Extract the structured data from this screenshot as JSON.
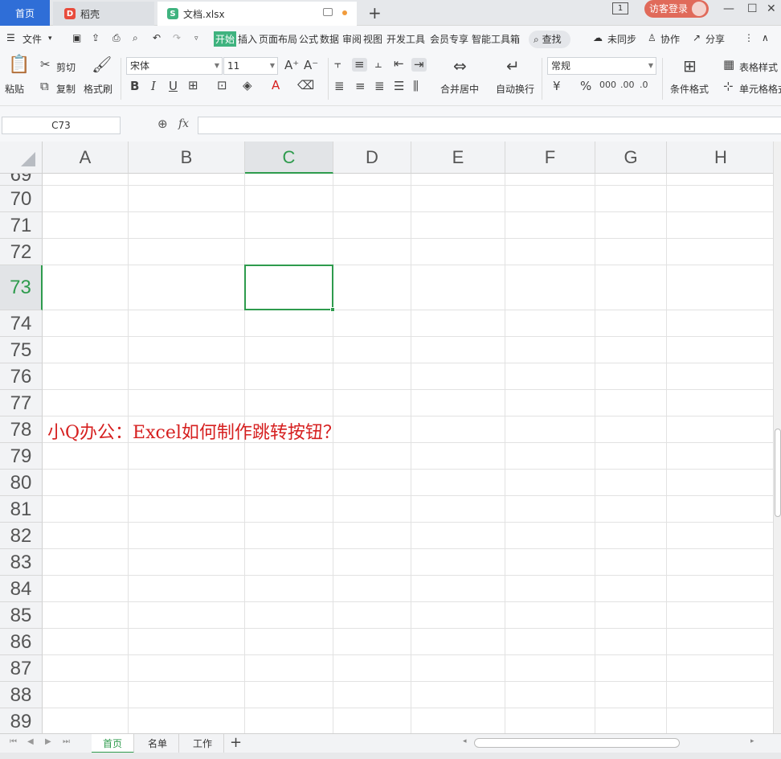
{
  "tabs": {
    "home": "首页",
    "daoke": "稻壳",
    "doc": "文档.xlsx",
    "doc_icon": "S",
    "daoke_icon": "D"
  },
  "window": {
    "badge": "1",
    "login": "访客登录"
  },
  "menu": {
    "file": "文件",
    "items": [
      "开始",
      "插入",
      "页面布局",
      "公式",
      "数据",
      "审阅",
      "视图",
      "开发工具",
      "会员专享",
      "智能工具箱"
    ],
    "search": "查找",
    "unsync": "未同步",
    "collab": "协作",
    "share": "分享"
  },
  "ribbon": {
    "paste": "粘贴",
    "cut": "剪切",
    "copy": "复制",
    "format_painter": "格式刷",
    "font_name": "宋体",
    "font_size": "11",
    "bold": "B",
    "italic": "I",
    "underline": "U",
    "merge_center": "合并居中",
    "wrap_text": "自动换行",
    "number_format": "常规",
    "cond_format": "条件格式",
    "table_style": "表格样式",
    "cell_style": "单元格格式"
  },
  "formula_bar": {
    "name_box": "C73",
    "fx": "fx",
    "value": ""
  },
  "grid": {
    "columns": [
      "A",
      "B",
      "C",
      "D",
      "E",
      "F",
      "G",
      "H"
    ],
    "active_column": "C",
    "rows": [
      "69",
      "70",
      "71",
      "72",
      "73",
      "74",
      "75",
      "76",
      "77",
      "78",
      "79",
      "80",
      "81",
      "82",
      "83",
      "84",
      "85",
      "86",
      "87",
      "88",
      "89"
    ],
    "active_row": "73",
    "banner_text": "小Q办公：Excel如何制作跳转按钮？",
    "banner_color": "#d62020"
  },
  "sheets": [
    "首页",
    "名单",
    "工作"
  ],
  "active_sheet": "首页",
  "accent_color": "#2e9b4d"
}
